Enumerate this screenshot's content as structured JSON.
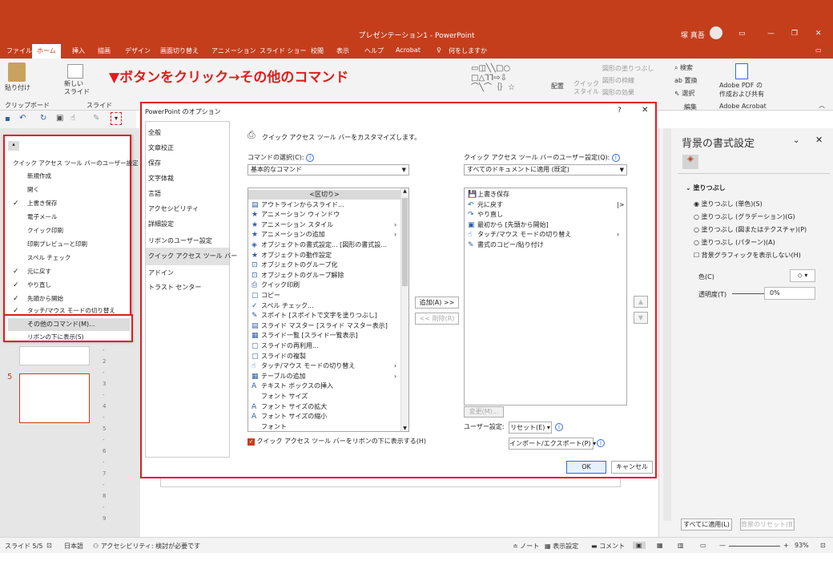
{
  "window": {
    "title": "プレゼンテーション1 - PowerPoint",
    "user": "塚 真吾"
  },
  "tabs": [
    "ファイル",
    "ホーム",
    "挿入",
    "描画",
    "デザイン",
    "画面切り替え",
    "アニメーション",
    "スライド ショー",
    "校閲",
    "表示",
    "ヘルプ",
    "Acrobat"
  ],
  "tell_me": "何をしますか",
  "ribbon": {
    "paste": "貼り付け",
    "new_slide": "新しい\nスライド",
    "clipboard": "クリップボード",
    "slide_group": "スライド",
    "arrange": "配置",
    "quick_style": "クイック\nスタイル",
    "shape_fill": "図形の塗りつぶし",
    "shape_outline": "図形の枠線",
    "shape_effects": "図形の効果",
    "find": "検索",
    "replace": "置換",
    "select": "選択",
    "editing": "編集",
    "adobe_pdf": "Adobe PDF の\n作成および共有",
    "adobe_acrobat": "Adobe Acrobat"
  },
  "annotation": "▼ボタンをクリック→その他のコマンド",
  "qat_dropdown": {
    "header": "クイック アクセス ツール バーのユーザー設定",
    "items": [
      {
        "label": "新規作成",
        "checked": false
      },
      {
        "label": "開く",
        "checked": false
      },
      {
        "label": "上書き保存",
        "checked": true
      },
      {
        "label": "電子メール",
        "checked": false
      },
      {
        "label": "クイック印刷",
        "checked": false
      },
      {
        "label": "印刷プレビューと印刷",
        "checked": false
      },
      {
        "label": "スペル チェック",
        "checked": false
      },
      {
        "label": "元に戻す",
        "checked": true
      },
      {
        "label": "やり直し",
        "checked": true
      },
      {
        "label": "先頭から開始",
        "checked": true
      },
      {
        "label": "タッチ/マウス モードの切り替え",
        "checked": true
      }
    ],
    "more_commands": "その他のコマンド(M)...",
    "show_below": "リボンの下に表示(S)"
  },
  "slide_thumb_number": "5",
  "dialog": {
    "title": "PowerPoint のオプション",
    "help": "?",
    "close": "✕",
    "nav": [
      "全般",
      "文章校正",
      "保存",
      "文字体裁",
      "言語",
      "アクセシビリティ",
      "詳細設定",
      "リボンのユーザー設定",
      "クイック アクセス ツール バー",
      "アドイン",
      "トラスト センター"
    ],
    "nav_selected": 8,
    "heading": "クイック アクセス ツール バーをカスタマイズします。",
    "choose_label": "コマンドの選択(C):",
    "choose_value": "基本的なコマンド",
    "customize_label": "クイック アクセス ツール バーのユーザー設定(Q):",
    "customize_value": "すべてのドキュメントに適用 (既定)",
    "commands": [
      {
        "icon": "",
        "label": "<区切り>"
      },
      {
        "icon": "▤",
        "label": "アウトラインからスライド..."
      },
      {
        "icon": "★",
        "label": "アニメーション ウィンドウ"
      },
      {
        "icon": "★",
        "label": "アニメーション スタイル"
      },
      {
        "icon": "★",
        "label": "アニメーションの追加"
      },
      {
        "icon": "◈",
        "label": "オブジェクトの書式設定... [図形の書式設..."
      },
      {
        "icon": "★",
        "label": "オブジェクトの動作設定"
      },
      {
        "icon": "⊡",
        "label": "オブジェクトのグループ化"
      },
      {
        "icon": "⊡",
        "label": "オブジェクトのグループ解除"
      },
      {
        "icon": "⎙",
        "label": "クイック印刷"
      },
      {
        "icon": "▢",
        "label": "コピー"
      },
      {
        "icon": "✓",
        "label": "スペル チェック..."
      },
      {
        "icon": "✎",
        "label": "スポイト [スポイトで文字を塗りつぶし]"
      },
      {
        "icon": "▤",
        "label": "スライド マスター [スライド マスター表示]"
      },
      {
        "icon": "▦",
        "label": "スライド一覧 [スライド一覧表示]"
      },
      {
        "icon": "▢",
        "label": "スライドの再利用..."
      },
      {
        "icon": "▢",
        "label": "スライドの複製"
      },
      {
        "icon": "☝",
        "label": "タッチ/マウス モードの切り替え"
      },
      {
        "icon": "▦",
        "label": "テーブルの追加"
      },
      {
        "icon": "A",
        "label": "テキスト ボックスの挿入"
      },
      {
        "icon": "",
        "label": "フォント サイズ"
      },
      {
        "icon": "A",
        "label": "フォント サイズの拡大"
      },
      {
        "icon": "A",
        "label": "フォント サイズの縮小"
      },
      {
        "icon": "",
        "label": "フォント"
      }
    ],
    "qat_items": [
      {
        "icon": "💾",
        "label": "上書き保存"
      },
      {
        "icon": "↶",
        "label": "元に戻す"
      },
      {
        "icon": "↷",
        "label": "やり直し"
      },
      {
        "icon": "▣",
        "label": "最初から [先頭から開始]"
      },
      {
        "icon": "☝",
        "label": "タッチ/マウス モードの切り替え"
      },
      {
        "icon": "✎",
        "label": "書式のコピー/貼り付け"
      }
    ],
    "add_button": "追加(A) >>",
    "remove_button": "<< 削除(R)",
    "modify_button": "変更(M)...",
    "user_settings_label": "ユーザー設定:",
    "reset_button": "リセット(E) ▾",
    "import_export_button": "インポート/エクスポート(P) ▾",
    "show_below_checkbox": "クイック アクセス ツール バーをリボンの下に表示する(H)",
    "ok": "OK",
    "cancel": "キャンセル"
  },
  "format_pane": {
    "title": "背景の書式設定",
    "section": "塗りつぶし",
    "options": [
      "塗りつぶし (単色)(S)",
      "塗りつぶし (グラデーション)(G)",
      "塗りつぶし (図またはテクスチャ)(P)",
      "塗りつぶし (パターン)(A)"
    ],
    "hide_graphics": "背景グラフィックを表示しない(H)",
    "color_label": "色(C)",
    "transparency_label": "透明度(T)",
    "transparency_value": "0%",
    "apply_all": "すべてに適用(L)",
    "reset_bg": "背景のリセット(B)"
  },
  "status": {
    "slide": "スライド 5/5",
    "language": "日本語",
    "accessibility": "アクセシビリティ: 検討が必要です",
    "notes": "ノート",
    "display_settings": "表示設定",
    "comments": "コメント",
    "zoom": "93%"
  },
  "colors": {
    "brand": "#c43e1c",
    "highlight": "#e01c1c"
  }
}
